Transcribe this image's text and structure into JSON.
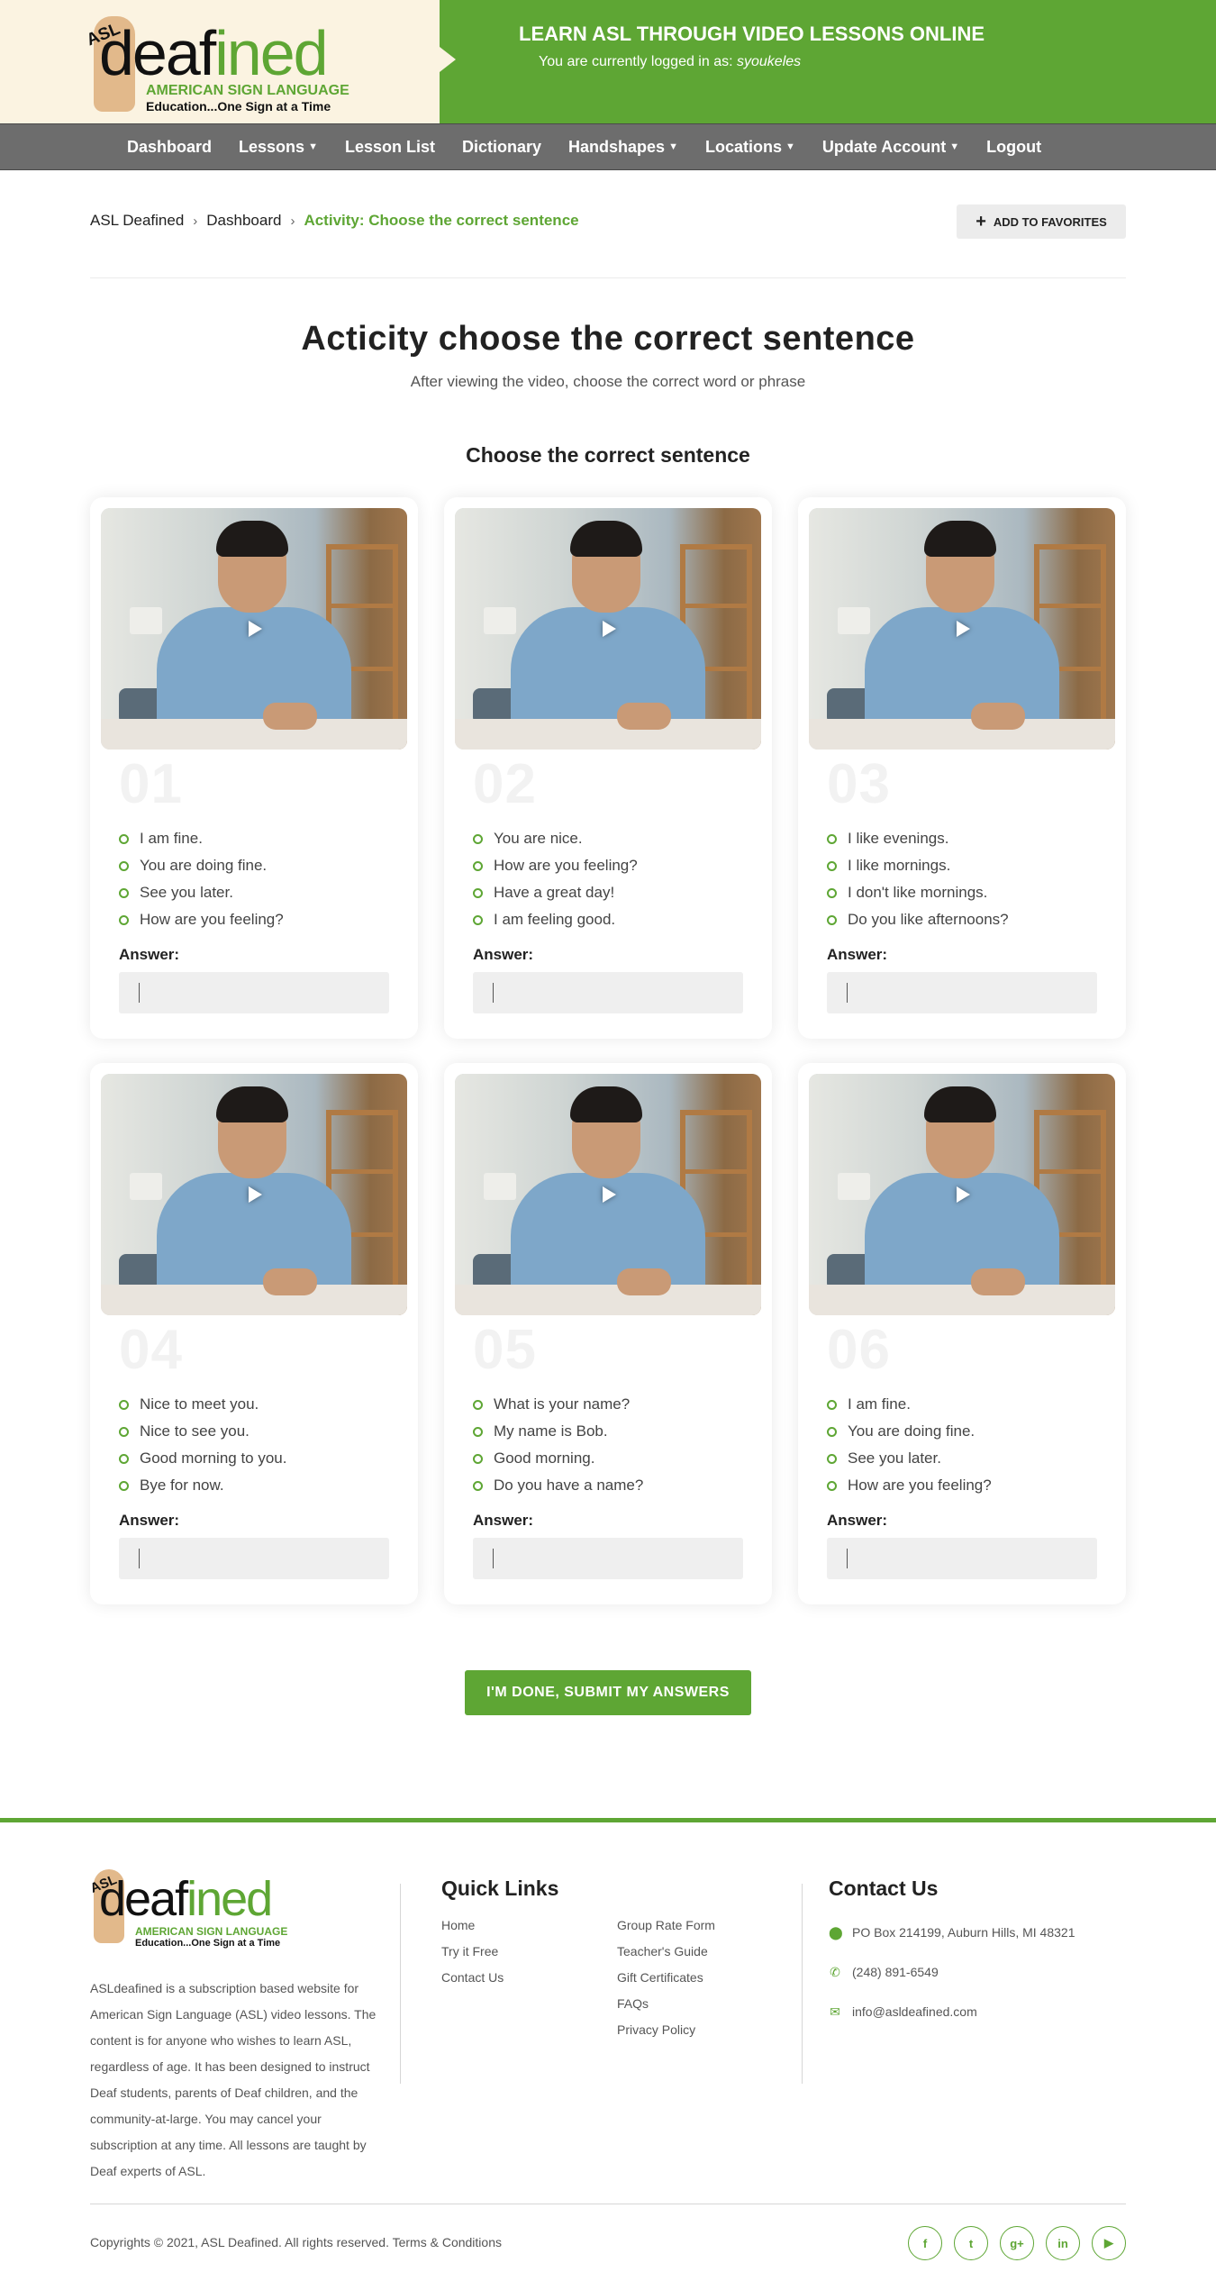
{
  "header": {
    "logo": {
      "asl": "ASL",
      "word_dark": "deaf",
      "word_green": "ined",
      "tagline1": "AMERICAN SIGN LANGUAGE",
      "tagline2": "Education...One Sign at a Time"
    },
    "banner_title": "LEARN ASL THROUGH VIDEO LESSONS ONLINE",
    "login_prefix": "You are currently logged in as:",
    "username": "syoukeles",
    "brand_color": "#5ea634"
  },
  "nav": {
    "items": [
      {
        "label": "Dashboard",
        "dropdown": false
      },
      {
        "label": "Lessons",
        "dropdown": true
      },
      {
        "label": "Lesson List",
        "dropdown": false
      },
      {
        "label": "Dictionary",
        "dropdown": false
      },
      {
        "label": "Handshapes",
        "dropdown": true
      },
      {
        "label": "Locations",
        "dropdown": true
      },
      {
        "label": "Update Account",
        "dropdown": true
      },
      {
        "label": "Logout",
        "dropdown": false
      }
    ]
  },
  "breadcrumb": {
    "items": [
      "ASL Deafined",
      "Dashboard",
      "Activity: Choose the correct sentence"
    ],
    "separator": "›"
  },
  "favorites_button": "ADD TO FAVORITES",
  "page": {
    "title": "Acticity choose the correct sentence",
    "subtitle": "After viewing the video, choose the correct word or phrase",
    "section_title": "Choose the correct sentence"
  },
  "cards": [
    {
      "number": "01",
      "options": [
        "I am fine.",
        "You are doing fine.",
        "See you later.",
        "How are you feeling?"
      ],
      "answer_label": "Answer:",
      "answer_value": ""
    },
    {
      "number": "02",
      "options": [
        "You are nice.",
        "How are you feeling?",
        "Have a great day!",
        "I am feeling good."
      ],
      "answer_label": "Answer:",
      "answer_value": ""
    },
    {
      "number": "03",
      "options": [
        "I like evenings.",
        "I like mornings.",
        "I don't like mornings.",
        "Do you like afternoons?"
      ],
      "answer_label": "Answer:",
      "answer_value": ""
    },
    {
      "number": "04",
      "options": [
        "Nice to meet you.",
        "Nice to see you.",
        "Good morning to you.",
        "Bye for now."
      ],
      "answer_label": "Answer:",
      "answer_value": ""
    },
    {
      "number": "05",
      "options": [
        "What is your name?",
        "My name is Bob.",
        "Good morning.",
        "Do you have a name?"
      ],
      "answer_label": "Answer:",
      "answer_value": ""
    },
    {
      "number": "06",
      "options": [
        "I am fine.",
        "You are doing fine.",
        "See you later.",
        "How are you feeling?"
      ],
      "answer_label": "Answer:",
      "answer_value": ""
    }
  ],
  "submit_button": "I'M DONE, SUBMIT MY ANSWERS",
  "footer": {
    "about": "ASLdeafined is a subscription based website for American Sign Language (ASL) video lessons. The content is for anyone who wishes to learn ASL, regardless of age. It has been designed to instruct Deaf students, parents of Deaf children, and the community-at-large. You may cancel your subscription at any time. All lessons are taught by Deaf experts of ASL.",
    "quick_links_heading": "Quick Links",
    "links_col1": [
      "Home",
      "Try it Free",
      "Contact Us"
    ],
    "links_col2": [
      "Group Rate Form",
      "Teacher's Guide",
      "Gift Certificates",
      "FAQs",
      "Privacy Policy"
    ],
    "contact_heading": "Contact Us",
    "contact": [
      {
        "icon": "map-pin-icon",
        "text": "PO Box 214199, Auburn Hills, MI 48321"
      },
      {
        "icon": "phone-icon",
        "text": "(248) 891-6549"
      },
      {
        "icon": "envelope-icon",
        "text": "info@asldeafined.com"
      }
    ],
    "copyright": "Copyrights © 2021, ASL Deafined. All rights reserved. Terms & Conditions",
    "socials": [
      {
        "icon": "facebook-icon",
        "glyph": "f"
      },
      {
        "icon": "twitter-icon",
        "glyph": "t"
      },
      {
        "icon": "google-plus-icon",
        "glyph": "g+"
      },
      {
        "icon": "linkedin-icon",
        "glyph": "in"
      },
      {
        "icon": "youtube-icon",
        "glyph": "▶"
      }
    ]
  }
}
